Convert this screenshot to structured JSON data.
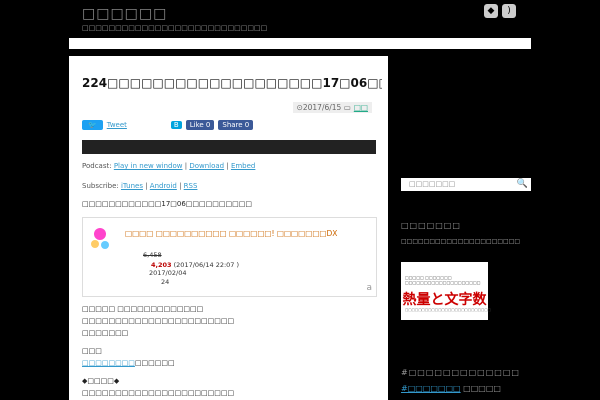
{
  "header": {
    "title": "□□□□□□",
    "description": "□□□□□□□□□□□□□□□□□□□□□□□□□□□□",
    "icons": [
      "feedly-icon",
      "rss-icon"
    ]
  },
  "post": {
    "title": "224□□□□□□□□□□□□□□□□□□□17□06□□",
    "date": "2017/6/15",
    "category": "□□",
    "tweet_label": "Tweet",
    "like_label": "Like 0",
    "share_label": "Share 0",
    "podcast_label": "Podcast:",
    "play_link": "Play in new window",
    "download_link": "Download",
    "embed_link": "Embed",
    "subscribe_label": "Subscribe:",
    "itunes_link": "iTunes",
    "android_link": "Android",
    "rss_link": "RSS",
    "intro": "□□□□□□□□□□□□17□06□□□□□□□□□□",
    "lines": [
      "□□□□□ □□□□□□□□□□□□□",
      "□□□□□□□□□□□□□□□□□□□□□□□",
      "□□□□□□□",
      "□□□",
      "□□□□□□□□",
      "◆□□□□◆",
      "□□□□□□□□□□□□□□□□□□□□□□□"
    ],
    "link_inline": "□□□□□□□□",
    "link_inline_suffix": "□□□□□□"
  },
  "amazon": {
    "title": "□□□□ □□□□□□□□□□ □□□□□□! □□□□□□□DX",
    "old_price": "6,458",
    "price": "4,203",
    "price_date": "(2017/06/14 22:07",
    "price_date_tail": ")",
    "release": "2017/02/04",
    "count": "24",
    "logo": "a"
  },
  "sidebar": {
    "search_placeholder": "□□□□□□□",
    "widget1_title": "□□□□□□□",
    "widget1_sub": "□□□□□□□□□□□□□□□□□□□□□",
    "banner_top": "□□□□□ □□□□□□□ □□□□□□□□□□□□□□□□□□□□",
    "banner_main": "熱量と文字数",
    "banner_bot": "□□□□□□□□□□□□□□□□□□□□□□□□□□",
    "widget2_title": "#□□□□□□□□□□□□□",
    "tag_link": "#□□□□□□□",
    "tag_suffix": "□□□□□"
  }
}
